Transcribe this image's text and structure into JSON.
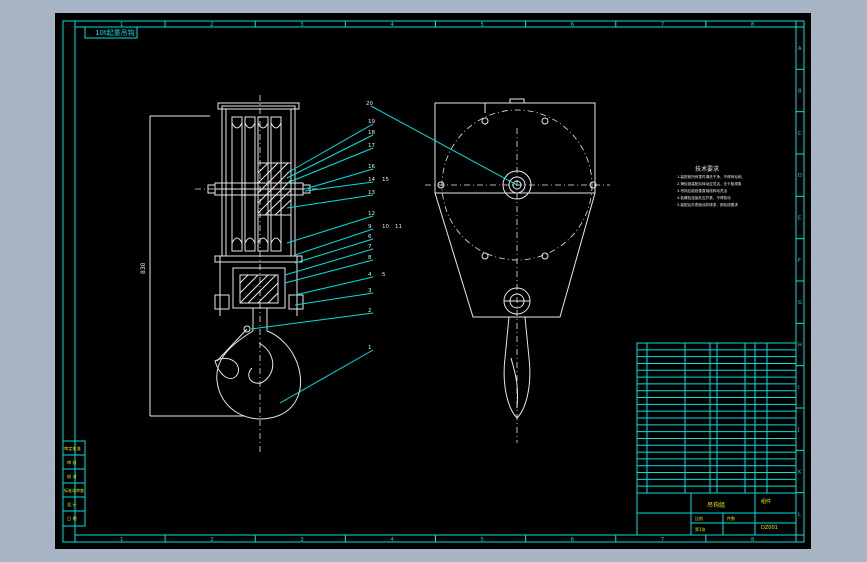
{
  "drawing": {
    "title_tag": "10t起重吊钩",
    "columns": [
      "1",
      "2",
      "3",
      "4",
      "5",
      "6",
      "7",
      "8"
    ],
    "rows": [
      "A",
      "B",
      "C",
      "D",
      "E",
      "F",
      "G",
      "H",
      "I",
      "J",
      "K",
      "L"
    ],
    "callouts": [
      "1",
      "2",
      "3",
      "4",
      "5",
      "6",
      "7",
      "8",
      "9",
      "10",
      "11",
      "12",
      "13",
      "14",
      "15",
      "16",
      "17",
      "18",
      "19",
      "20"
    ],
    "dimension_label": "830",
    "tech_notes": {
      "heading": "技术要求",
      "lines": [
        "1.装配前所有零件清洗干净，不得有毛刺、",
        "2.滑轮组装配后转动应灵活，无卡阻现象",
        "3.吊钩应能绕垂直轴线转动灵活",
        "4.各螺栓连接处应拧紧，不得松动",
        "5.装配后外表面涂防锈漆，颜色按要求"
      ]
    },
    "left_block": [
      "审定批准",
      "审 核",
      "校 对",
      "标准化审查",
      "设 计",
      "日 期"
    ],
    "title_block": {
      "name": "吊钩组",
      "material": "组件",
      "code": "DZ001",
      "scale": "比例",
      "qty": "件数",
      "sheet": "第1张"
    }
  }
}
